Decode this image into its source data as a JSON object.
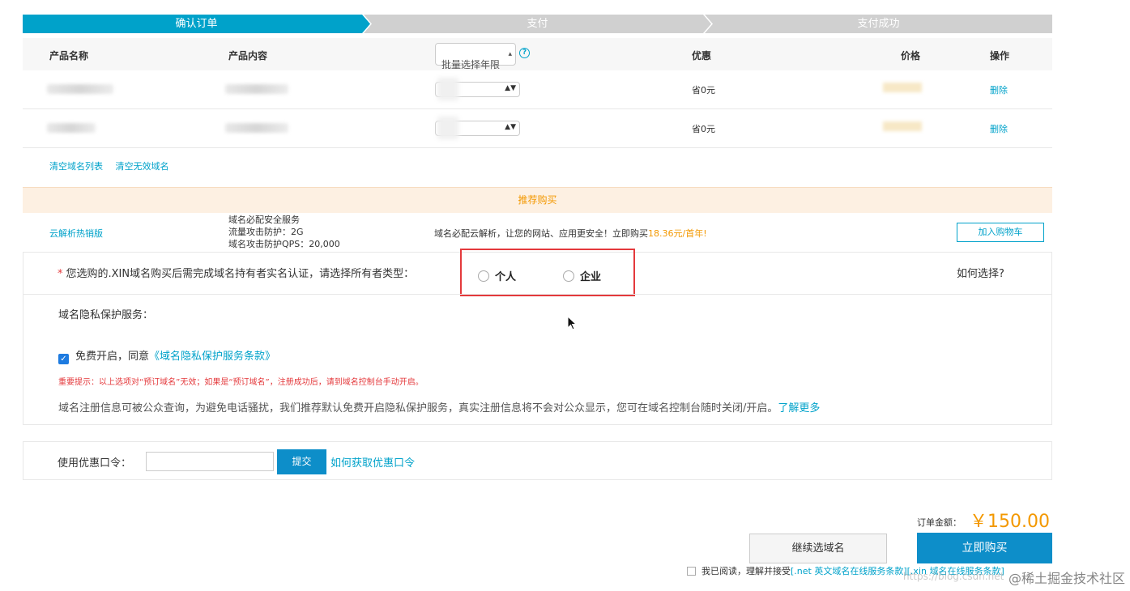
{
  "steps": [
    "确认订单",
    "支付",
    "支付成功"
  ],
  "table": {
    "headers": {
      "name": "产品名称",
      "content": "产品内容",
      "batch_select": "批量选择年限",
      "discount": "优惠",
      "price": "价格",
      "action": "操作"
    },
    "rows": [
      {
        "discount": "省0元",
        "action": "删除"
      },
      {
        "discount": "省0元",
        "action": "删除"
      }
    ]
  },
  "clear_links": [
    "清空域名列表",
    "清空无效域名"
  ],
  "recommend": {
    "title": "推荐购买",
    "product": "云解析热销版",
    "spec": [
      "域名必配安全服务",
      "流量攻击防护：2G",
      "域名攻击防护QPS：20,000"
    ],
    "desc": "域名必配云解析，让您的网站、应用更安全！立即购买",
    "price": "18.36元/首年!",
    "add_cart": "加入购物车"
  },
  "owner": {
    "required_mark": "*",
    "question": "您选购的.XIN域名购买后需完成域名持有者实名认证，请选择所有者类型：",
    "options": [
      "个人",
      "企业"
    ],
    "how": "如何选择?"
  },
  "privacy": {
    "title": "域名隐私保护服务：",
    "check_text": "免费开启，同意",
    "check_link": "《域名隐私保护服务条款》",
    "warning": "重要提示：以上选项对“预订域名”无效；如果是“预订域名”，注册成功后，请到域名控制台手动开启。",
    "info": "域名注册信息可被公众查询，为避免电话骚扰，我们推荐默认免费开启隐私保护服务，真实注册信息将不会对公众显示，您可在域名控制台随时关闭/开启。",
    "info_link": "了解更多"
  },
  "coupon": {
    "label": "使用优惠口令：",
    "input_value": "",
    "submit": "提交",
    "link": "如何获取优惠口令"
  },
  "order": {
    "total_label": "订单金额：",
    "total_amount": "￥150.00",
    "continue": "继续选域名",
    "buy": "立即购买",
    "agree_text": "我已阅读，理解并接受",
    "agree_link": "[.net 英文域名在线服务条款][.xin 域名在线服务条款]"
  },
  "watermark": "@稀土掘金技术社区",
  "watermark_url": "https://blog.csdn.net"
}
